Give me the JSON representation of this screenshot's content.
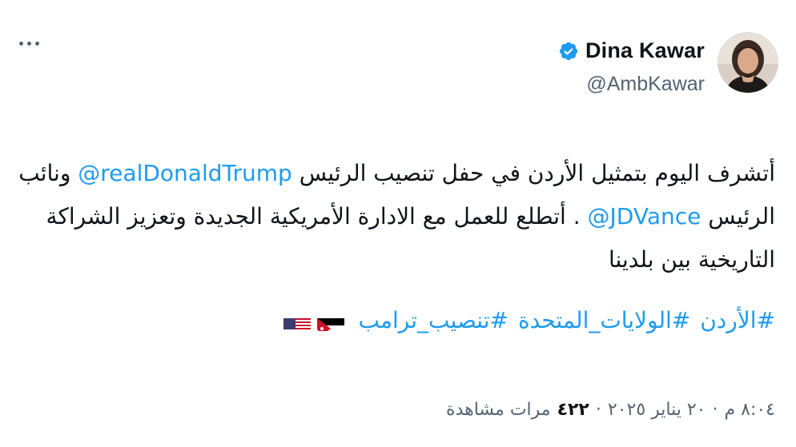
{
  "author": {
    "display_name": "Dina Kawar",
    "handle": "@AmbKawar",
    "verified": true,
    "avatar_icon": "profile-photo"
  },
  "more_menu": {
    "icon": "more-horizontal-icon"
  },
  "tweet": {
    "line1_prefix": "أتشرف اليوم بتمثيل الأردن في حفل تنصيب الرئيس ",
    "mention1": "@realDonaldTrump",
    "line1_suffix": " ونائب الرئيس ",
    "mention2": "@JDVance",
    "line2_suffix": " . أتطلع للعمل مع الادارة الأمريكية الجديدة وتعزيز الشراكة التاريخية بين بلدينا",
    "hashtags": [
      "#الأردن",
      "#الولايات_المتحدة",
      "#تنصيب_ترامب"
    ],
    "flags": [
      "us-flag",
      "jordan-flag"
    ]
  },
  "meta": {
    "time": "٨:٠٤ م",
    "separator1": "·",
    "date": "٢٠ يناير ٢٠٢٥",
    "separator2": "·",
    "views_count": "٤٢٢",
    "views_label": "مرات مشاهدة"
  },
  "colors": {
    "link": "#1d9bf0",
    "text": "#0f1419",
    "secondary": "#536471"
  }
}
